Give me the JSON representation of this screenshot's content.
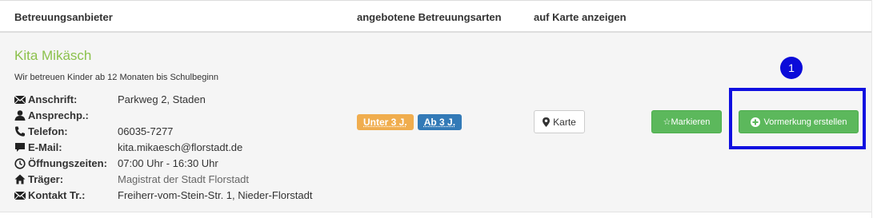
{
  "table": {
    "headers": {
      "provider": "Betreuungsanbieter",
      "care_types": "angebotene Betreuungsarten",
      "map": "auf Karte anzeigen"
    },
    "rows": [
      {
        "name": "Kita Mikäsch",
        "description": "Wir betreuen Kinder ab 12 Monaten bis Schulbeginn",
        "details": [
          {
            "label": "Anschrift:",
            "value": "Parkweg 2, Staden",
            "icon": "envelope-icon"
          },
          {
            "label": "Ansprechp.:",
            "value": "",
            "icon": "user-icon"
          },
          {
            "label": "Telefon:",
            "value": "06035-7277",
            "icon": "phone-icon"
          },
          {
            "label": "E-Mail:",
            "value": "kita.mikaesch@florstadt.de",
            "icon": "comment-icon"
          },
          {
            "label": "Öffnungszeiten:",
            "value": "07:00 Uhr - 16:30 Uhr",
            "icon": "clock-icon"
          },
          {
            "label": "Träger:",
            "value": "Magistrat der Stadt Florstadt",
            "icon": "home-icon"
          },
          {
            "label": "Kontakt Tr.:",
            "value": "Freiherr-vom-Stein-Str. 1, Nieder-Florstadt",
            "icon": "envelope-icon"
          }
        ],
        "badges": [
          {
            "label": "Unter 3 J.",
            "color": "#f0ad4e"
          },
          {
            "label": "Ab 3 J.",
            "color": "#337ab7"
          }
        ],
        "map_button": "Karte",
        "mark_button": "☆Markieren",
        "reserve_button": "Vormerkung erstellen"
      }
    ]
  },
  "annotation": {
    "marker_label": "1",
    "color": "#1010e0"
  },
  "colors": {
    "name_green": "#8cc14c",
    "button_green": "#5cb85c"
  }
}
